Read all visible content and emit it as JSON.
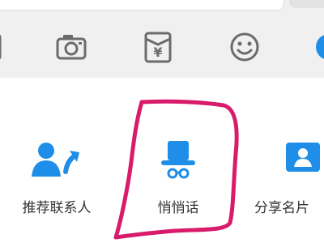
{
  "colors": {
    "accent_blue": "#1e8ee8",
    "icon_gray": "#6b6b6b",
    "annotation": "#d81b6b"
  },
  "toolbar": {
    "icons": [
      "camera-icon",
      "red-packet-icon",
      "emoji-icon"
    ],
    "red_packet_symbol": "¥"
  },
  "features": [
    {
      "id": "recommend-contact",
      "label": "推荐联系人",
      "icon": "add-contact-icon"
    },
    {
      "id": "whisper",
      "label": "悄悄话",
      "icon": "incognito-hat-icon"
    },
    {
      "id": "share-card",
      "label": "分享名片",
      "icon": "contact-card-icon"
    }
  ]
}
